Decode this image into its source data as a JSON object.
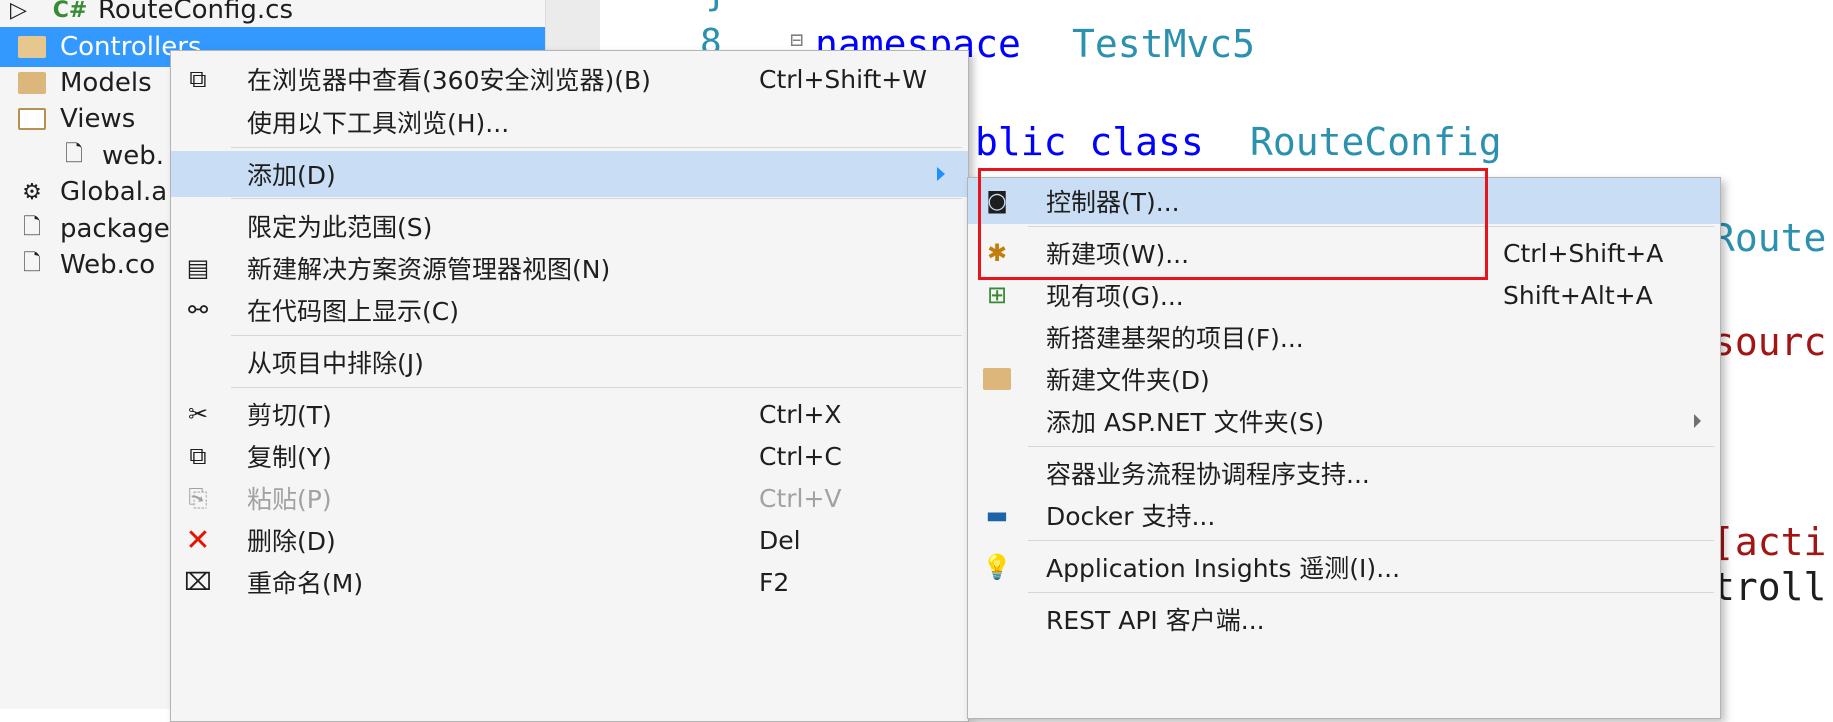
{
  "solution_explorer": {
    "items": [
      {
        "label": "RouteConfig.cs",
        "icon": "csharp-file-icon",
        "expander": "▷"
      },
      {
        "label": "Controllers",
        "icon": "folder-icon",
        "selected": true
      },
      {
        "label": "Models",
        "icon": "folder-icon"
      },
      {
        "label": "Views",
        "icon": "folder-open-icon"
      },
      {
        "label": "web.",
        "icon": "config-file-icon"
      },
      {
        "label": "Global.a",
        "icon": "global-asax-icon"
      },
      {
        "label": "package",
        "icon": "config-file-icon"
      },
      {
        "label": "Web.co",
        "icon": "config-file-icon"
      }
    ]
  },
  "editor": {
    "line_number": "8",
    "collapse_marker": "⊟",
    "keyword_namespace": "namespace",
    "namespace_name": "TestMvc5",
    "class_keywords": "blic class",
    "class_name": "RouteConfig",
    "fragment_route": "Route",
    "fragment_resource": "sourc",
    "fragment_action": "[acti",
    "fragment_controller": "troll",
    "fragment_top": "}"
  },
  "context_menu": {
    "items": [
      {
        "label": "在浏览器中查看(360安全浏览器)(B)",
        "shortcut": "Ctrl+Shift+W",
        "icon": "browser-view-icon"
      },
      {
        "label": "使用以下工具浏览(H)...",
        "shortcut": "",
        "icon": ""
      },
      {
        "label": "添加(D)",
        "shortcut": "",
        "icon": "",
        "submenu": true,
        "highlighted": true
      },
      {
        "label": "限定为此范围(S)",
        "shortcut": "",
        "icon": ""
      },
      {
        "label": "新建解决方案资源管理器视图(N)",
        "shortcut": "",
        "icon": "new-explorer-view-icon"
      },
      {
        "label": "在代码图上显示(C)",
        "shortcut": "",
        "icon": "code-map-icon"
      },
      {
        "label": "从项目中排除(J)",
        "shortcut": "",
        "icon": ""
      },
      {
        "label": "剪切(T)",
        "shortcut": "Ctrl+X",
        "icon": "cut-icon"
      },
      {
        "label": "复制(Y)",
        "shortcut": "Ctrl+C",
        "icon": "copy-icon"
      },
      {
        "label": "粘贴(P)",
        "shortcut": "Ctrl+V",
        "icon": "paste-icon",
        "disabled": true
      },
      {
        "label": "删除(D)",
        "shortcut": "Del",
        "icon": "delete-icon"
      },
      {
        "label": "重命名(M)",
        "shortcut": "F2",
        "icon": "rename-icon"
      }
    ]
  },
  "add_submenu": {
    "items": [
      {
        "label": "控制器(T)...",
        "shortcut": "",
        "icon": "controller-icon",
        "highlighted": true
      },
      {
        "label": "新建项(W)...",
        "shortcut": "Ctrl+Shift+A",
        "icon": "new-item-icon"
      },
      {
        "label": "现有项(G)...",
        "shortcut": "Shift+Alt+A",
        "icon": "existing-item-icon"
      },
      {
        "label": "新搭建基架的项目(F)...",
        "shortcut": "",
        "icon": ""
      },
      {
        "label": "新建文件夹(D)",
        "shortcut": "",
        "icon": "new-folder-icon"
      },
      {
        "label": "添加 ASP.NET 文件夹(S)",
        "shortcut": "",
        "icon": "",
        "submenu": true
      },
      {
        "label": "容器业务流程协调程序支持...",
        "shortcut": "",
        "icon": ""
      },
      {
        "label": "Docker 支持...",
        "shortcut": "",
        "icon": "docker-icon"
      },
      {
        "label": "Application Insights 遥测(I)...",
        "shortcut": "",
        "icon": "app-insights-icon"
      },
      {
        "label": "REST API 客户端...",
        "shortcut": "",
        "icon": ""
      }
    ]
  },
  "colors": {
    "selection": "#3399ff",
    "menu_highlight": "#c9def5",
    "annotation_box": "#e8141c",
    "keyword": "#0000ff",
    "type": "#2b91af"
  }
}
